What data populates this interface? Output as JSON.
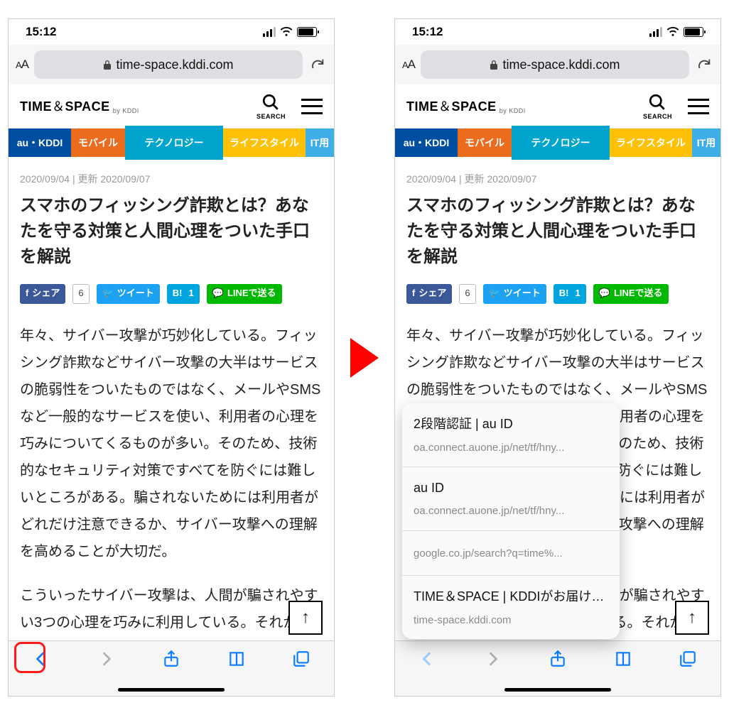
{
  "status": {
    "time": "15:12"
  },
  "addr": {
    "aa_small": "A",
    "aa_big": "A",
    "domain": "time-space.kddi.com"
  },
  "site": {
    "logo_main": "TIME",
    "logo_amp": "＆",
    "logo_sub": "SPACE",
    "logo_by": "by KDDI",
    "search_label": "SEARCH"
  },
  "tabs": {
    "au": "au・KDDI",
    "mobile": "モバイル",
    "tech": "テクノロジー",
    "life": "ライフスタイル",
    "it": "IT用"
  },
  "article": {
    "date": "2020/09/04 | 更新 2020/09/07",
    "title": "スマホのフィッシング詐欺とは？あなたを守る対策と人間心理をついた手口を解説",
    "p1": "年々、サイバー攻撃が巧妙化している。フィッシング詐欺などサイバー攻撃の大半はサービスの脆弱性をついたものではなく、メールやSMSなど一般的なサービスを使い、利用者の心理を巧みについてくるものが多い。そのため、技術的なセキュリティ対策ですべてを防ぐには難しいところがある。騙されないためには利用者がどれだけ注意できるか、サイバー攻撃への理解を高めることが大切だ。",
    "p2": "こういったサイバー攻撃は、人間が騙されやすい3つの心理を巧みに利用している。それが「信頼性が高い」「やましい気持ち」「不安"
  },
  "share": {
    "fb": "シェア",
    "fb_count": "6",
    "tw": "ツイート",
    "hb": "B!",
    "hb_count": "1",
    "line": "LINEで送る"
  },
  "up_arrow": "↑",
  "history": [
    {
      "title": "2段階認証 | au ID",
      "url": "oa.connect.auone.jp/net/tf/hny..."
    },
    {
      "title": "au ID",
      "url": "oa.connect.auone.jp/net/tf/hny..."
    },
    {
      "title": "",
      "url": "google.co.jp/search?q=time%..."
    },
    {
      "title": "TIME＆SPACE | KDDIがお届け…",
      "url": "time-space.kddi.com"
    }
  ]
}
